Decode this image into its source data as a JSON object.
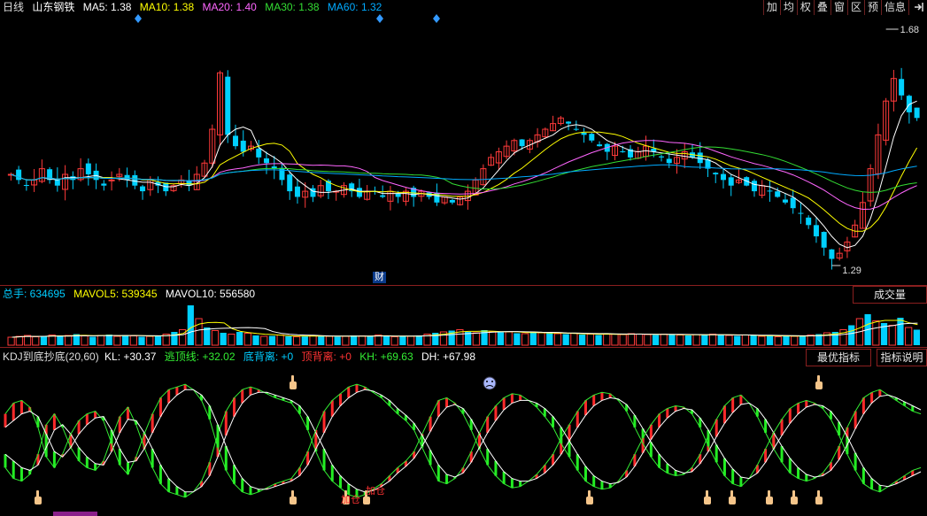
{
  "header": {
    "period": "日线",
    "stock_name": "山东钢铁",
    "ma": [
      {
        "label": "MA5: 1.38",
        "color": "#ffffff"
      },
      {
        "label": "MA10: 1.38",
        "color": "#ffff00"
      },
      {
        "label": "MA20: 1.40",
        "color": "#ff66ff"
      },
      {
        "label": "MA30: 1.38",
        "color": "#33dd33"
      },
      {
        "label": "MA60: 1.32",
        "color": "#00aaff"
      }
    ]
  },
  "toolbar": [
    "加",
    "均",
    "权",
    "叠",
    "窗",
    "区",
    "预",
    "信息",
    "exit-icon"
  ],
  "price_chart": {
    "high_label": "1.68",
    "low_label": "1.29",
    "finance_marker": "财",
    "candles": [
      1.45,
      1.44,
      1.43,
      1.44,
      1.46,
      1.44,
      1.43,
      1.45,
      1.44,
      1.46,
      1.45,
      1.44,
      1.43,
      1.44,
      1.45,
      1.44,
      1.43,
      1.42,
      1.44,
      1.43,
      1.42,
      1.43,
      1.44,
      1.43,
      1.45,
      1.47,
      1.53,
      1.63,
      1.52,
      1.5,
      1.49,
      1.5,
      1.48,
      1.47,
      1.46,
      1.44,
      1.42,
      1.41,
      1.42,
      1.41,
      1.43,
      1.42,
      1.42,
      1.43,
      1.42,
      1.41,
      1.42,
      1.42,
      1.41,
      1.42,
      1.41,
      1.42,
      1.41,
      1.42,
      1.41,
      1.4,
      1.41,
      1.4,
      1.41,
      1.42,
      1.44,
      1.46,
      1.48,
      1.49,
      1.5,
      1.51,
      1.5,
      1.51,
      1.52,
      1.53,
      1.54,
      1.55,
      1.54,
      1.53,
      1.52,
      1.51,
      1.5,
      1.49,
      1.5,
      1.49,
      1.48,
      1.49,
      1.5,
      1.49,
      1.48,
      1.47,
      1.48,
      1.49,
      1.48,
      1.47,
      1.46,
      1.45,
      1.44,
      1.43,
      1.44,
      1.43,
      1.42,
      1.43,
      1.42,
      1.41,
      1.4,
      1.39,
      1.38,
      1.36,
      1.34,
      1.32,
      1.3,
      1.31,
      1.33,
      1.36,
      1.4,
      1.46,
      1.52,
      1.58,
      1.62,
      1.59,
      1.56,
      1.55
    ],
    "ma_colors": [
      "#ffffff",
      "#ffff00",
      "#ff66ff",
      "#33dd33",
      "#00aaff"
    ]
  },
  "volume_panel": {
    "label": "总手: 634695",
    "mavol5": "MAVOL5: 539345",
    "mavol10": "MAVOL10: 556580",
    "dropdown": "成交量",
    "values": [
      0.18,
      0.2,
      0.22,
      0.19,
      0.21,
      0.23,
      0.2,
      0.22,
      0.25,
      0.21,
      0.19,
      0.22,
      0.24,
      0.2,
      0.23,
      0.21,
      0.19,
      0.2,
      0.22,
      0.25,
      0.3,
      0.35,
      0.9,
      0.6,
      0.4,
      0.33,
      0.28,
      0.25,
      0.3,
      0.27,
      0.22,
      0.2,
      0.21,
      0.23,
      0.2,
      0.19,
      0.2,
      0.22,
      0.21,
      0.2,
      0.19,
      0.2,
      0.22,
      0.21,
      0.2,
      0.23,
      0.2,
      0.19,
      0.21,
      0.2,
      0.22,
      0.25,
      0.28,
      0.3,
      0.33,
      0.35,
      0.3,
      0.28,
      0.34,
      0.31,
      0.29,
      0.3,
      0.27,
      0.26,
      0.3,
      0.28,
      0.27,
      0.26,
      0.25,
      0.27,
      0.24,
      0.25,
      0.23,
      0.26,
      0.25,
      0.24,
      0.26,
      0.25,
      0.24,
      0.23,
      0.25,
      0.24,
      0.23,
      0.22,
      0.24,
      0.23,
      0.25,
      0.24,
      0.22,
      0.21,
      0.23,
      0.22,
      0.2,
      0.21,
      0.19,
      0.22,
      0.2,
      0.21,
      0.23,
      0.25,
      0.28,
      0.3,
      0.35,
      0.45,
      0.6,
      0.7,
      0.55,
      0.5,
      0.45,
      0.62,
      0.4,
      0.35
    ]
  },
  "kdj_panel": {
    "title": "KDJ到底抄底(20,60)",
    "kl": "KL: +30.37",
    "escape": "逃顶线: +32.02",
    "bottom_div": "底背离: +0",
    "top_div": "顶背离: +0",
    "kh": "KH: +69.63",
    "dh": "DH: +67.98",
    "btn_best": "最优指标",
    "btn_help": "指标说明",
    "add_labels": [
      "加仓",
      "加仓"
    ],
    "k_line": [
      30,
      22,
      20,
      25,
      40,
      62,
      70,
      60,
      45,
      35,
      30,
      28,
      35,
      52,
      68,
      75,
      62,
      45,
      30,
      18,
      12,
      10,
      8,
      12,
      20,
      34,
      55,
      72,
      82,
      88,
      90,
      88,
      85,
      82,
      80,
      78,
      70,
      58,
      42,
      28,
      20,
      15,
      10,
      8,
      10,
      14,
      18,
      24,
      30,
      35,
      42,
      55,
      68,
      80,
      82,
      78,
      70,
      58,
      44,
      32,
      24,
      18,
      15,
      16,
      20,
      25,
      32,
      40,
      52,
      62,
      72,
      80,
      84,
      86,
      85,
      80,
      72,
      60,
      48,
      38,
      30,
      26,
      24,
      25,
      30,
      40,
      54,
      66,
      76,
      82,
      84,
      78,
      68,
      56,
      44,
      34,
      26,
      22,
      20,
      22,
      26,
      34,
      46,
      60,
      72,
      82,
      86,
      88,
      84,
      80,
      76,
      72,
      70
    ],
    "d_line": [
      40,
      35,
      30,
      28,
      32,
      45,
      58,
      62,
      55,
      45,
      38,
      33,
      32,
      42,
      56,
      66,
      65,
      56,
      44,
      32,
      22,
      16,
      12,
      12,
      16,
      24,
      38,
      54,
      68,
      78,
      84,
      86,
      86,
      84,
      82,
      80,
      76,
      68,
      56,
      44,
      32,
      24,
      18,
      14,
      12,
      13,
      16,
      20,
      26,
      31,
      37,
      46,
      57,
      68,
      75,
      77,
      74,
      66,
      55,
      44,
      35,
      27,
      22,
      20,
      20,
      22,
      26,
      32,
      40,
      50,
      60,
      69,
      76,
      80,
      82,
      81,
      77,
      69,
      59,
      49,
      40,
      33,
      28,
      26,
      27,
      33,
      42,
      53,
      63,
      71,
      77,
      78,
      74,
      66,
      56,
      46,
      37,
      30,
      25,
      23,
      24,
      28,
      36,
      47,
      59,
      70,
      78,
      83,
      84,
      82,
      79,
      76,
      73
    ]
  }
}
